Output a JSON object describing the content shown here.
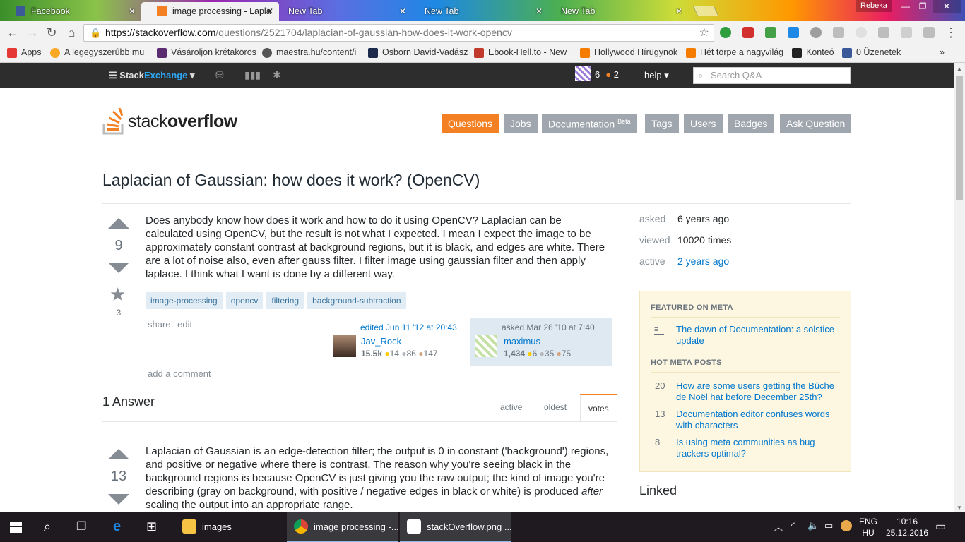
{
  "browser": {
    "tabs": [
      {
        "label": "Facebook",
        "favicon": "facebook-icon",
        "color": "#3b5998"
      },
      {
        "label": "image processing - Lapla",
        "favicon": "stackoverflow-icon",
        "color": "#f48024"
      },
      {
        "label": "New Tab",
        "favicon": "",
        "color": ""
      },
      {
        "label": "New Tab",
        "favicon": "",
        "color": ""
      },
      {
        "label": "New Tab",
        "favicon": "",
        "color": ""
      }
    ],
    "profile": "Rebeka",
    "url_host": "https://stackoverflow.com",
    "url_path": "/questions/2521704/laplacian-of-gaussian-how-does-it-work-opencv",
    "bookmarks": [
      {
        "label": "Apps",
        "icon": "apps-grid-icon",
        "color": "#e53935"
      },
      {
        "label": "A legegyszerűbb mu",
        "icon": "bookmark-n-icon",
        "color": "#f9a825"
      },
      {
        "label": "Vásároljon krétakörös",
        "icon": "bookmark-d-icon",
        "color": "#5b2c6f"
      },
      {
        "label": "maestra.hu/content/i",
        "icon": "bulb-icon",
        "color": "#555555"
      },
      {
        "label": "Osborn David-Vadász",
        "icon": "bookmark-s-icon",
        "color": "#1b2a4a"
      },
      {
        "label": "Ebook-Hell.to - New",
        "icon": "books-icon",
        "color": "#c0392b"
      },
      {
        "label": "Hollywood Hírügynök",
        "icon": "blogger-icon",
        "color": "#f57c00"
      },
      {
        "label": "Hét törpe a nagyvilág",
        "icon": "blogger-icon",
        "color": "#f57c00"
      },
      {
        "label": "Konteó",
        "icon": "konteo-icon",
        "color": "#222222"
      },
      {
        "label": "0 Üzenetek",
        "icon": "facebook-icon",
        "color": "#3b5998"
      }
    ]
  },
  "topbar": {
    "logo_a": "Stack",
    "logo_b": "Exchange",
    "rep": "6",
    "badges": "2",
    "help": "help",
    "search_placeholder": "Search Q&A"
  },
  "site": {
    "logo_a": "stack",
    "logo_b": "overflow",
    "nav": [
      "Questions",
      "Jobs",
      "Documentation",
      "Tags",
      "Users",
      "Badges",
      "Ask Question"
    ],
    "doc_badge": "Beta"
  },
  "question": {
    "title": "Laplacian of Gaussian: how does it work? (OpenCV)",
    "votes": "9",
    "favorites": "3",
    "body": "Does anybody know how does it work and how to do it using OpenCV? Laplacian can be calculated using OpenCV, but the result is not what I expected. I mean I expect the image to be approximately constant contrast at background regions, but it is black, and edges are white. There are a lot of noise also, even after gauss filter. I filter image using gaussian filter and then apply laplace. I think what I want is done by a different way.",
    "tags": [
      "image-processing",
      "opencv",
      "filtering",
      "background-subtraction"
    ],
    "menu": [
      "share",
      "edit"
    ],
    "editor": {
      "action": "edited Jun 11 '12 at 20:43",
      "name": "Jav_Rock",
      "rep": "15.5k",
      "gold": "14",
      "silver": "86",
      "bronze": "147"
    },
    "owner": {
      "action": "asked Mar 26 '10 at 7:40",
      "name": "maximus",
      "rep": "1,434",
      "gold": "6",
      "silver": "35",
      "bronze": "75"
    },
    "add_comment": "add a comment"
  },
  "answers": {
    "heading": "1 Answer",
    "sort_tabs": [
      "active",
      "oldest",
      "votes"
    ],
    "first": {
      "votes": "13",
      "body_a": "Laplacian of Gaussian is an edge-detection filter; the output is 0 in constant ('background') regions, and positive or negative where there is contrast. The reason why you're seeing black in the background regions is because OpenCV is just giving you the raw output; the kind of image you're describing (gray on background, with positive / negative edges in black or white) is produced ",
      "body_em": "after",
      "body_b": " scaling the output into an appropriate range."
    }
  },
  "sidebar": {
    "asked_k": "asked",
    "asked_v": "6 years ago",
    "viewed_k": "viewed",
    "viewed_v": "10020 times",
    "active_k": "active",
    "active_v": "2 years ago",
    "featured_h": "FEATURED ON META",
    "featured": [
      {
        "title": "The dawn of Documentation: a solstice update"
      }
    ],
    "hot_h": "HOT META POSTS",
    "hot": [
      {
        "num": "20",
        "title": "How are some users getting the Bûche de Noël hat before December 25th?"
      },
      {
        "num": "13",
        "title": "Documentation editor confuses words with characters"
      },
      {
        "num": "8",
        "title": "Is using meta communities as bug trackers optimal?"
      }
    ],
    "linked_h": "Linked"
  },
  "taskbar": {
    "tasks": [
      "images",
      "image processing -...",
      "stackOverflow.png ..."
    ],
    "lang_a": "ENG",
    "lang_b": "HU",
    "time": "10:16",
    "date": "25.12.2016"
  }
}
